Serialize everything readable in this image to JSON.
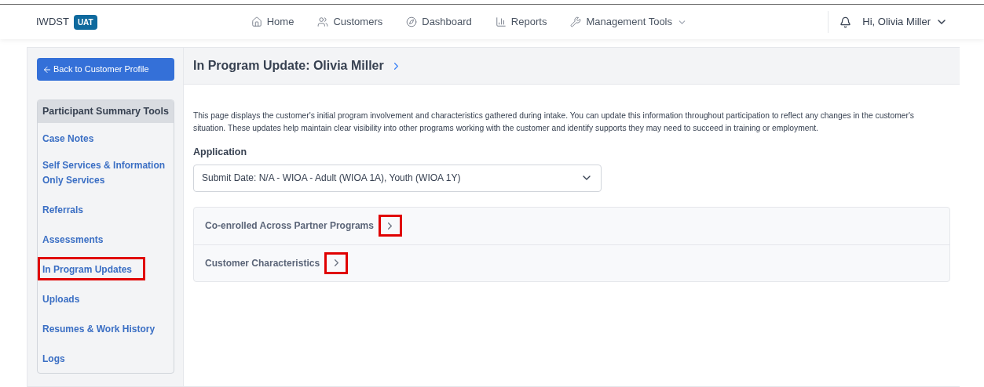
{
  "brand": {
    "name": "IWDST",
    "badge": "UAT"
  },
  "nav": [
    {
      "label": "Home",
      "kind": "home",
      "dropdown": false
    },
    {
      "label": "Customers",
      "kind": "users",
      "dropdown": false
    },
    {
      "label": "Dashboard",
      "kind": "compass",
      "dropdown": false
    },
    {
      "label": "Reports",
      "kind": "chart",
      "dropdown": false
    },
    {
      "label": "Management Tools",
      "kind": "wrench",
      "dropdown": true
    }
  ],
  "user": {
    "greeting": "Hi, Olivia Miller"
  },
  "back_button": "Back to Customer Profile",
  "sidebar": {
    "title": "Participant Summary Tools",
    "items": [
      {
        "label": "Case Notes",
        "highlighted": false
      },
      {
        "label": "Self Services & Information Only Services",
        "highlighted": false
      },
      {
        "label": "Referrals",
        "highlighted": false
      },
      {
        "label": "Assessments",
        "highlighted": false
      },
      {
        "label": "In Program Updates",
        "highlighted": true
      },
      {
        "label": "Uploads",
        "highlighted": false
      },
      {
        "label": "Resumes & Work History",
        "highlighted": false
      },
      {
        "label": "Logs",
        "highlighted": false
      }
    ]
  },
  "page": {
    "title": "In Program Update: Olivia Miller",
    "description": "This page displays the customer's initial program involvement and characteristics gathered during intake. You can update this information throughout participation to reflect any changes in the customer's situation. These updates help maintain clear visibility into other programs working with the customer and identify supports they may need to succeed in training or employment.",
    "application_label": "Application",
    "application_value": "Submit Date: N/A - WIOA - Adult (WIOA 1A), Youth (WIOA 1Y)",
    "sections": [
      {
        "title": "Co-enrolled Across Partner Programs",
        "expanded": false,
        "highlighted": true
      },
      {
        "title": "Customer Characteristics",
        "expanded": false,
        "highlighted": true
      }
    ]
  }
}
